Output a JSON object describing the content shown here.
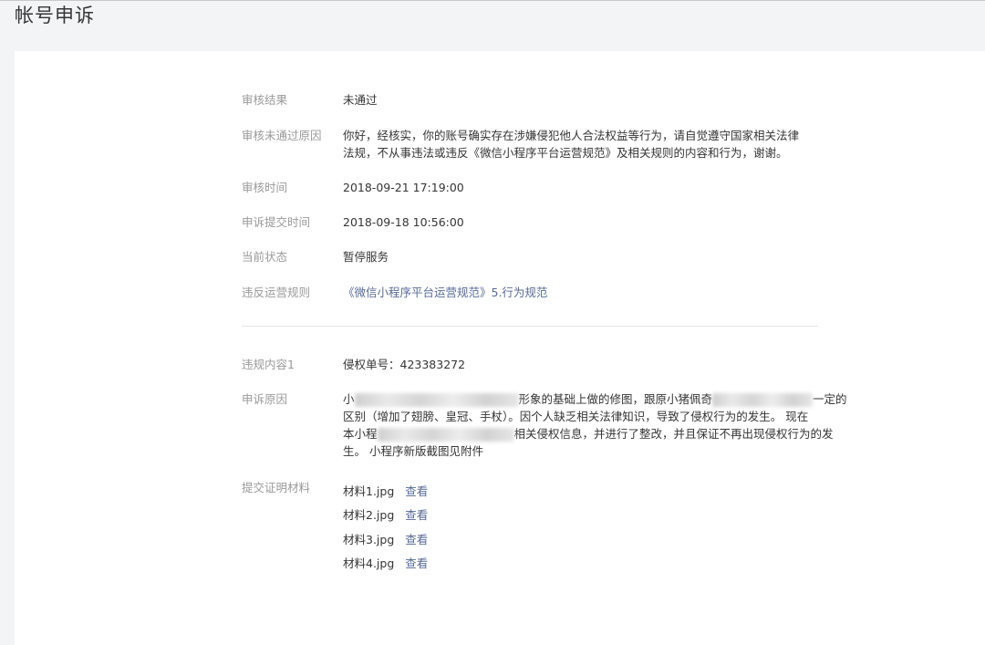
{
  "page": {
    "title": "帐号申诉"
  },
  "audit": {
    "result_label": "审核结果",
    "result_value": "未通过",
    "reason_label": "审核未通过原因",
    "reason_value": "你好，经核实，你的账号确实存在涉嫌侵犯他人合法权益等行为，请自觉遵守国家相关法律法规，不从事违法或违反《微信小程序平台运营规范》及相关规则的内容和行为，谢谢。",
    "time_label": "审核时间",
    "time_value": "2018-09-21 17:19:00",
    "submit_time_label": "申诉提交时间",
    "submit_time_value": "2018-09-18 10:56:00",
    "status_label": "当前状态",
    "status_value": "暂停服务",
    "rule_label": "违反运营规则",
    "rule_link": "《微信小程序平台运营规范》5.行为规范"
  },
  "violation": {
    "content_label": "违规内容1",
    "content_value": "侵权单号：423383272",
    "appeal_label": "申诉原因",
    "appeal_line1_a": "小",
    "appeal_line1_b": "形象的基础上做的修图，跟原小猪佩奇",
    "appeal_line1_c": "一定的",
    "appeal_line2": "区别（增加了翅膀、皇冠、手杖）。因个人缺乏相关法律知识，导致了侵权行为的发生。 现在",
    "appeal_line3_a": "本小程",
    "appeal_line3_b": "相关侵权信息，并进行了整改，并且保证不再出现侵权行为的发",
    "appeal_line4": "生。 小程序新版截图见附件",
    "materials_label": "提交证明材料",
    "materials": [
      {
        "name": "材料1.jpg",
        "action": "查看"
      },
      {
        "name": "材料2.jpg",
        "action": "查看"
      },
      {
        "name": "材料3.jpg",
        "action": "查看"
      },
      {
        "name": "材料4.jpg",
        "action": "查看"
      }
    ]
  }
}
